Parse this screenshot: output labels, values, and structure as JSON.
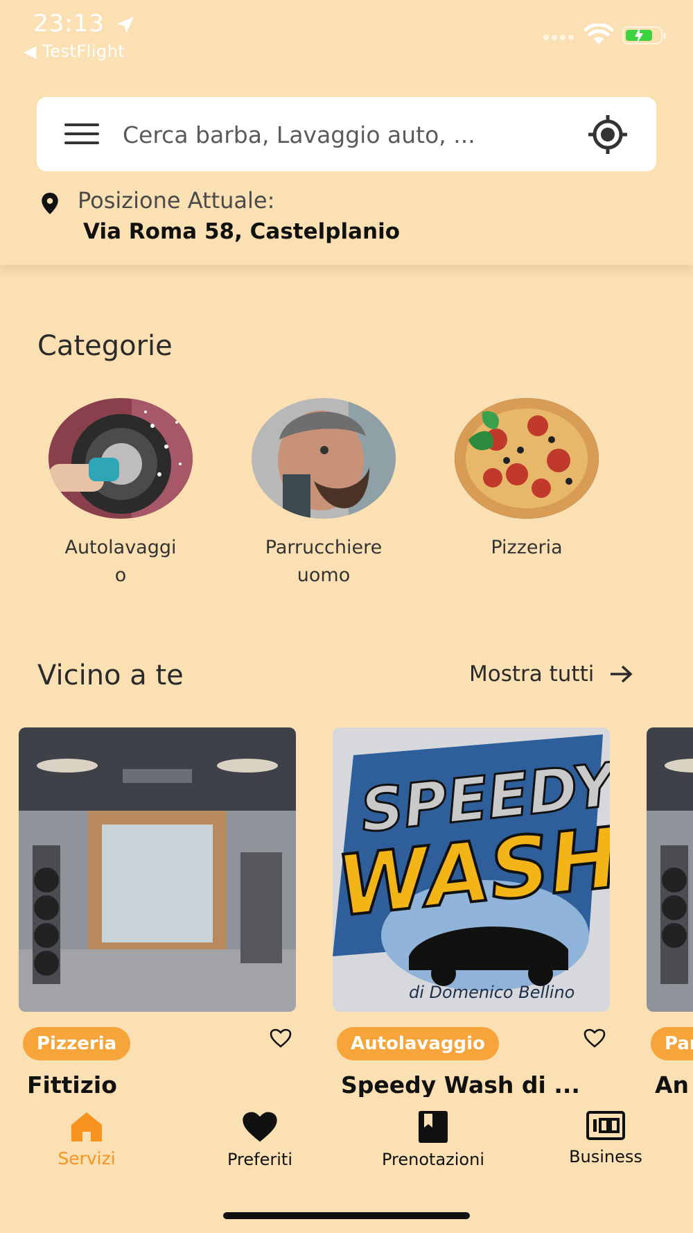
{
  "status_bar": {
    "time": "23:13",
    "back_app": "◀ TestFlight"
  },
  "search": {
    "placeholder": "Cerca barba, Lavaggio auto, ..."
  },
  "location": {
    "label": "Posizione Attuale:",
    "value": "Via Roma 58, Castelplanio"
  },
  "categories": {
    "title": "Categorie",
    "items": [
      {
        "label": "Autolavaggi\no",
        "icon": "car-wash-photo"
      },
      {
        "label": "Parrucchiere\nuomo",
        "icon": "barber-photo"
      },
      {
        "label": "Pizzeria",
        "icon": "pizza-photo"
      }
    ]
  },
  "nearby": {
    "title": "Vicino a te",
    "show_all": "Mostra tutti",
    "cards": [
      {
        "badge": "Pizzeria",
        "name": "Fittizio"
      },
      {
        "badge": "Autolavaggio",
        "name": "Speedy Wash di ...",
        "logo_line1": "SPEEDY",
        "logo_line2": "WASH",
        "logo_caption": "di Domenico Bellino"
      },
      {
        "badge": "Par",
        "name": "An"
      }
    ]
  },
  "bottom_nav": {
    "items": [
      {
        "label": "Servizi",
        "active": true
      },
      {
        "label": "Preferiti"
      },
      {
        "label": "Prenotazioni"
      },
      {
        "label": "Business"
      }
    ]
  },
  "colors": {
    "background": "#fbe0b3",
    "accent": "#f7931e",
    "badge": "#f7a43a"
  }
}
